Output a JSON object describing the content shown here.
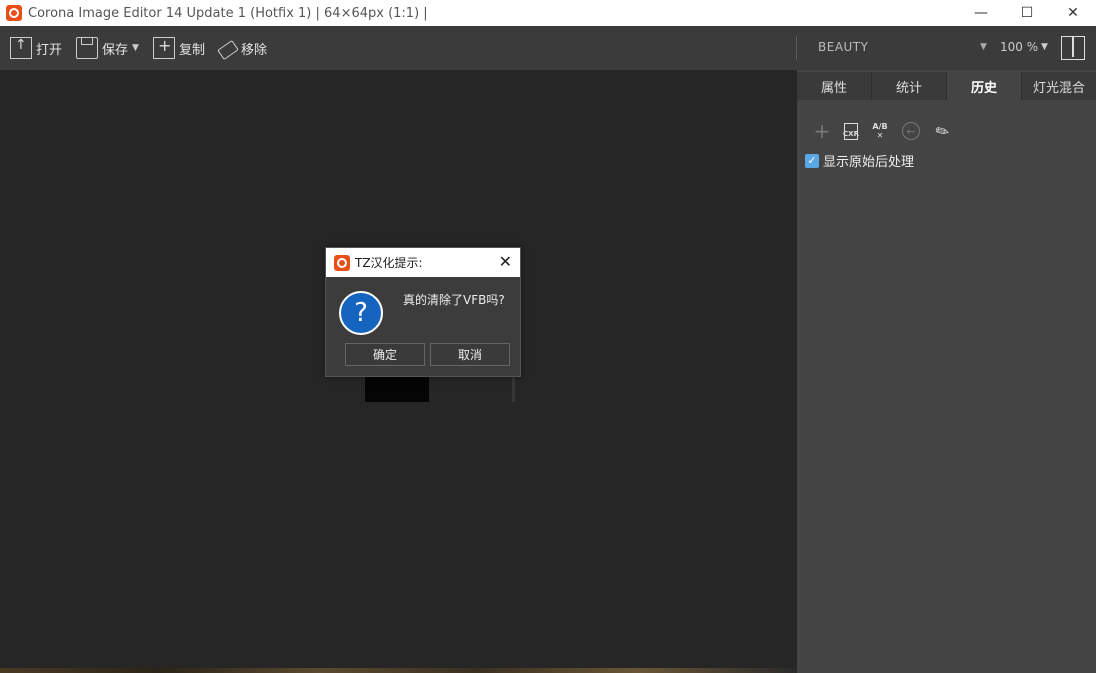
{
  "window": {
    "title": "Corona Image Editor 14 Update 1 (Hotfix 1) | 64×64px (1:1) |",
    "minimize": "—",
    "maximize": "☐",
    "close": "✕"
  },
  "toolbar": {
    "open_label": "打开",
    "save_label": "保存",
    "copy_label": "复制",
    "remove_label": "移除",
    "render_element": "BEAUTY",
    "zoom": "100 %"
  },
  "panel": {
    "tabs": [
      {
        "label": "属性",
        "active": false
      },
      {
        "label": "统计",
        "active": false
      },
      {
        "label": "历史",
        "active": true
      },
      {
        "label": "灯光混合",
        "active": false
      }
    ],
    "tools": [
      {
        "icon": "add-icon",
        "glyph": "+"
      },
      {
        "icon": "save-cxr-icon",
        "glyph": "CXR"
      },
      {
        "icon": "ab-compare-clear-icon",
        "glyph_top": "A/B",
        "glyph_bottom": "✕"
      },
      {
        "icon": "back-icon",
        "glyph": "←"
      },
      {
        "icon": "brush-icon",
        "glyph": "✎"
      }
    ],
    "show_original_label": "显示原始后处理",
    "show_original_checked": true
  },
  "dialog": {
    "title": "TZ汉化提示:",
    "close": "✕",
    "question_glyph": "?",
    "message": "真的清除了VFB吗?",
    "ok_label": "确定",
    "cancel_label": "取消"
  },
  "colors": {
    "accent": "#e8501a",
    "question": "#1565c0",
    "checkbox": "#5aa7e6"
  }
}
